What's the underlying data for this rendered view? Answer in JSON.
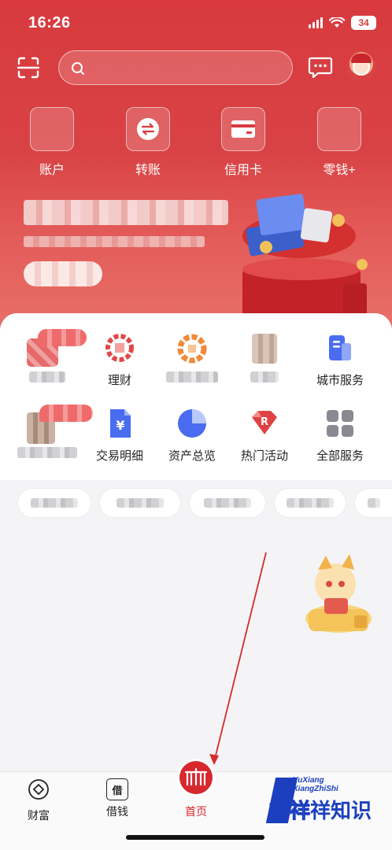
{
  "status_bar": {
    "time": "16:26",
    "battery": "34"
  },
  "header": {
    "search_placeholder": "",
    "icons": {
      "scan": "scan-icon",
      "search": "search-icon",
      "message": "message-icon",
      "avatar": "avatar"
    }
  },
  "quick_actions": [
    {
      "label": "账户",
      "icon": "account-icon"
    },
    {
      "label": "转账",
      "icon": "transfer-icon"
    },
    {
      "label": "信用卡",
      "icon": "credit-card-icon"
    },
    {
      "label": "零钱+",
      "icon": "change-icon"
    }
  ],
  "services_row1": [
    {
      "label": "",
      "icon": "blurred-icon"
    },
    {
      "label": "理财",
      "icon": "wealth-icon"
    },
    {
      "label": "",
      "icon": "blurred-icon"
    },
    {
      "label": "",
      "icon": "blurred-icon"
    },
    {
      "label": "城市服务",
      "icon": "city-service-icon"
    }
  ],
  "services_row2": [
    {
      "label": "",
      "icon": "blurred-icon"
    },
    {
      "label": "交易明细",
      "icon": "yuan-document-icon"
    },
    {
      "label": "资产总览",
      "icon": "pie-chart-icon"
    },
    {
      "label": "热门活动",
      "icon": "diamond-r-icon"
    },
    {
      "label": "全部服务",
      "icon": "grid-icon"
    }
  ],
  "bottom_nav": [
    {
      "label": "财富",
      "icon": "diamond-circle-icon"
    },
    {
      "label": "借钱",
      "icon": "borrow-icon",
      "glyph": "借"
    },
    {
      "label": "首页",
      "icon": "citic-logo-icon",
      "active": true
    }
  ],
  "watermark": {
    "small_line1": "YuXiang",
    "small_line2": "XiangZhiShi",
    "text_a": "誉祥",
    "text_b": "祥知识"
  },
  "colors": {
    "brand_red": "#d6282d",
    "hero_red": "#d83a3e",
    "blue": "#4a6cf0"
  }
}
